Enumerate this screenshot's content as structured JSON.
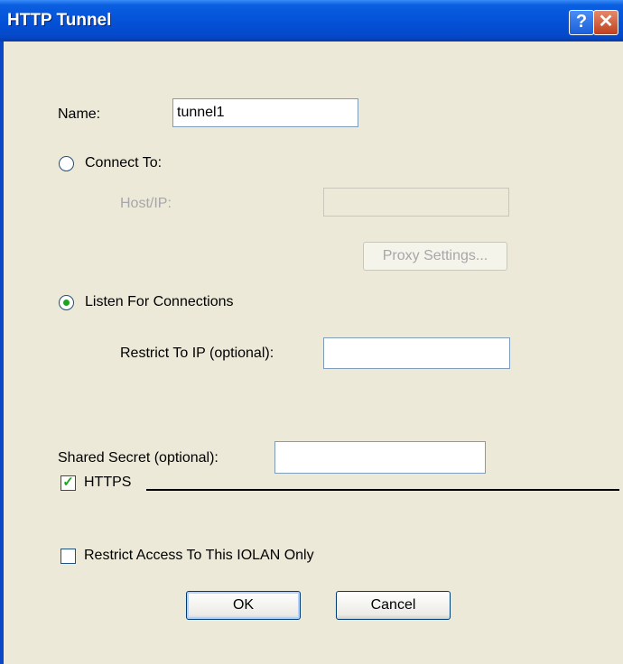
{
  "window": {
    "title": "HTTP Tunnel",
    "help_label": "?",
    "close_label": "✕"
  },
  "form": {
    "name_label": "Name:",
    "name_value": "tunnel1",
    "connect_to_label": "Connect To:",
    "connect_to_selected": false,
    "host_label": "Host/IP:",
    "host_value": "",
    "proxy_settings_label": "Proxy Settings...",
    "listen_label": "Listen For Connections",
    "listen_selected": true,
    "restrict_ip_label": "Restrict To IP (optional):",
    "restrict_ip_value": "",
    "shared_secret_label": "Shared Secret (optional):",
    "shared_secret_value": "",
    "https_label": "HTTPS",
    "https_checked": true,
    "restrict_access_label": "Restrict Access To This IOLAN Only",
    "restrict_access_checked": false
  },
  "buttons": {
    "ok_label": "OK",
    "cancel_label": "Cancel"
  },
  "colors": {
    "titlebar": "#0452d8",
    "dialog_bg": "#ece9d8",
    "check_mark": "#21a121"
  }
}
